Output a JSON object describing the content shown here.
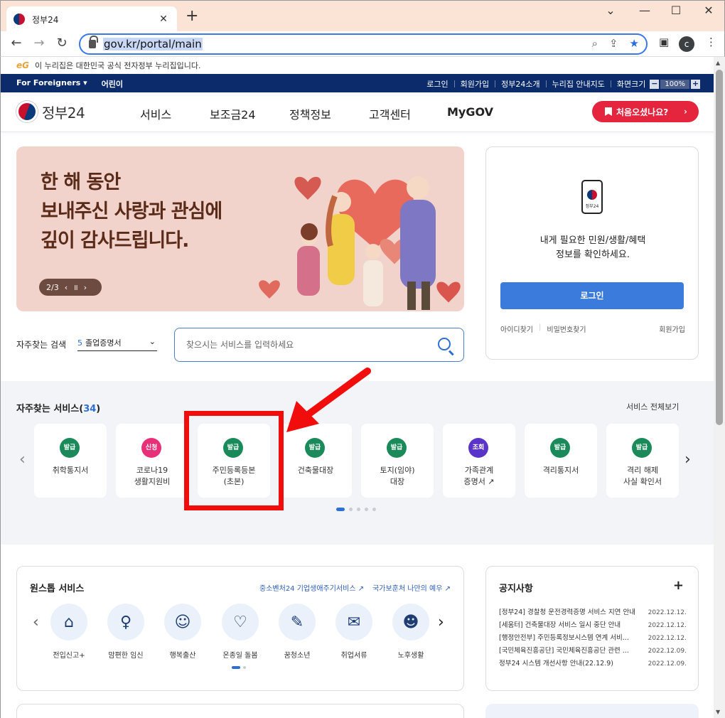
{
  "browser": {
    "tab_title": "정부24",
    "tab_close": "✕",
    "new_tab": "+",
    "url": "gov.kr/portal/main",
    "profile_initial": "c",
    "window_controls": [
      "⌄",
      "—",
      "☐",
      "✕"
    ]
  },
  "gov_notice": {
    "logo_text": "eG",
    "text": "이 누리집은 대한민국 공식 전자정부 누리집입니다."
  },
  "utility": {
    "left": [
      "For Foreigners ▾",
      "어린이"
    ],
    "right": [
      "로그인",
      "회원가입",
      "정부24소개",
      "누리집 안내지도",
      "화면크기"
    ],
    "zoom_minus": "−",
    "zoom_value": "100%",
    "zoom_plus": "+"
  },
  "header": {
    "logo_text": "정부24",
    "menu": [
      "서비스",
      "보조금24",
      "정책정보",
      "고객센터",
      "MyGOV"
    ],
    "first_visit": "처음오셨나요?",
    "first_visit_chevron": "›"
  },
  "banner": {
    "headline": [
      "한 해 동안",
      "보내주신 사랑과 관심에",
      "깊이 감사드립니다."
    ],
    "pager": "2/3",
    "prev": "‹",
    "pause": "॥",
    "next": "›"
  },
  "login": {
    "phone_label": "정부24",
    "message": [
      "내게 필요한 민원/생활/혜택",
      "정보를 확인하세요."
    ],
    "button": "로그인",
    "find_id": "아이디찾기",
    "find_pw": "비밀번호찾기",
    "signup": "회원가입"
  },
  "search": {
    "label": "자주찾는 검색",
    "rank": "5",
    "keyword": "졸업증명서",
    "placeholder": "찾으시는 서비스를 입력하세요"
  },
  "services": {
    "title": "자주찾는 서비스(",
    "count": "34",
    "title_end": ")",
    "view_all": "서비스 전체보기",
    "prev": "‹",
    "next": "›",
    "items": [
      {
        "badge": "발급",
        "color": "#1a8a5a",
        "name": "취학통지서"
      },
      {
        "badge": "신청",
        "color": "#e8307a",
        "name": "코로나19\n생활지원비"
      },
      {
        "badge": "발급",
        "color": "#1a8a5a",
        "name": "주민등록등본\n(초본)"
      },
      {
        "badge": "발급",
        "color": "#1a8a5a",
        "name": "건축물대장"
      },
      {
        "badge": "발급",
        "color": "#1a8a5a",
        "name": "토지(임야)\n대장"
      },
      {
        "badge": "조회",
        "color": "#5a33c9",
        "name": "가족관계\n증명서 ↗"
      },
      {
        "badge": "발급",
        "color": "#1a8a5a",
        "name": "격리통지서"
      },
      {
        "badge": "발급",
        "color": "#1a8a5a",
        "name": "격리 해제\n사실 확인서"
      }
    ]
  },
  "onestop": {
    "title": "원스톱 서비스",
    "links": [
      "중소벤처24 기업생애주기서비스 ↗",
      "국가보훈처 나만의 예우 ↗"
    ],
    "prev": "‹",
    "next": "›",
    "items": [
      {
        "icon": "house-icon",
        "glyph": "⌂",
        "label": "전입신고+"
      },
      {
        "icon": "pregnant-icon",
        "glyph": "♀",
        "label": "맘편한 임신"
      },
      {
        "icon": "baby-icon",
        "glyph": "☺",
        "label": "행복출산"
      },
      {
        "icon": "ribbon-icon",
        "glyph": "♡",
        "label": "온종일 돌봄"
      },
      {
        "icon": "book-icon",
        "glyph": "✎",
        "label": "꿈청소년"
      },
      {
        "icon": "briefcase-icon",
        "glyph": "✉",
        "label": "취업서류"
      },
      {
        "icon": "elder-icon",
        "glyph": "☻",
        "label": "노후생활"
      }
    ]
  },
  "notice": {
    "title": "공지사항",
    "plus": "+",
    "items": [
      {
        "title": "[정부24] 경찰청 운전경력증명 서비스 지연 안내",
        "date": "2022.12.12."
      },
      {
        "title": "[세움터] 건축물대장 서비스 일시 중단 안내",
        "date": "2022.12.12."
      },
      {
        "title": "[행정안전부] 주민등록정보시스템 연계 서비...",
        "date": "2022.12.12."
      },
      {
        "title": "[국민체육진흥공단] 국민체육진흥공단 관련 ...",
        "date": "2022.12.09."
      },
      {
        "title": "정부24 시스템 개선사항 안내(22.12.9)",
        "date": "2022.12.09."
      }
    ]
  },
  "colors": {
    "accent": "#2e6fd6",
    "navy": "#0b2b6b",
    "red_button": "#e5243d",
    "highlight": "#f20d0d"
  }
}
